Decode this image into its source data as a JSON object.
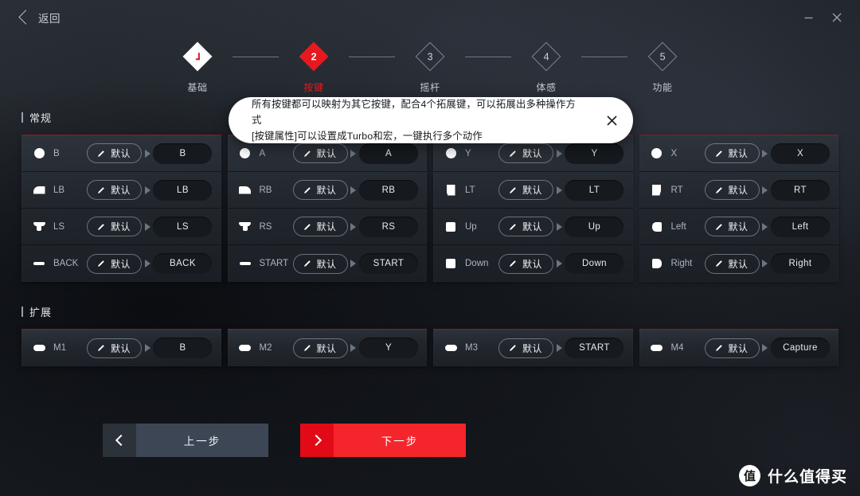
{
  "titlebar": {
    "back_label": "返回",
    "minimize_icon": "minimize-icon",
    "close_icon": "close-icon"
  },
  "stepper": {
    "steps": [
      {
        "num": "",
        "label": "基础",
        "state": "done"
      },
      {
        "num": "2",
        "label": "按键",
        "state": "active"
      },
      {
        "num": "3",
        "label": "摇杆",
        "state": "todo"
      },
      {
        "num": "4",
        "label": "体感",
        "state": "todo"
      },
      {
        "num": "5",
        "label": "功能",
        "state": "todo"
      }
    ],
    "active_color": "#e8191e"
  },
  "tooltip": {
    "line1": "所有按键都可以映射为其它按键，配合4个拓展键，可以拓展出多种操作方式",
    "line2": "[按键属性]可以设置成Turbo和宏，一键执行多个动作",
    "close_icon": "close-icon"
  },
  "sections": [
    {
      "title": "常规",
      "columns": [
        {
          "rows": [
            {
              "icon": "face-button-icon",
              "icon_shape": "face",
              "name": "B",
              "mode": "默认",
              "target": "B"
            },
            {
              "icon": "left-bumper-icon",
              "icon_shape": "bumperL",
              "name": "LB",
              "mode": "默认",
              "target": "LB"
            },
            {
              "icon": "left-stick-icon",
              "icon_shape": "stick",
              "name": "LS",
              "mode": "默认",
              "target": "LS"
            },
            {
              "icon": "back-button-icon",
              "icon_shape": "dash",
              "name": "BACK",
              "mode": "默认",
              "target": "BACK"
            }
          ]
        },
        {
          "rows": [
            {
              "icon": "face-button-icon",
              "icon_shape": "face",
              "name": "A",
              "mode": "默认",
              "target": "A"
            },
            {
              "icon": "right-bumper-icon",
              "icon_shape": "bumperR",
              "name": "RB",
              "mode": "默认",
              "target": "RB"
            },
            {
              "icon": "right-stick-icon",
              "icon_shape": "stick",
              "name": "RS",
              "mode": "默认",
              "target": "RS"
            },
            {
              "icon": "start-button-icon",
              "icon_shape": "dash",
              "name": "START",
              "mode": "默认",
              "target": "START"
            }
          ]
        },
        {
          "rows": [
            {
              "icon": "face-button-icon",
              "icon_shape": "face",
              "name": "Y",
              "mode": "默认",
              "target": "Y"
            },
            {
              "icon": "left-trigger-icon",
              "icon_shape": "trigL",
              "name": "LT",
              "mode": "默认",
              "target": "LT"
            },
            {
              "icon": "dpad-up-icon",
              "icon_shape": "dpad",
              "name": "Up",
              "mode": "默认",
              "target": "Up"
            },
            {
              "icon": "dpad-down-icon",
              "icon_shape": "dpad",
              "name": "Down",
              "mode": "默认",
              "target": "Down"
            }
          ]
        },
        {
          "rows": [
            {
              "icon": "face-button-icon",
              "icon_shape": "face",
              "name": "X",
              "mode": "默认",
              "target": "X"
            },
            {
              "icon": "right-trigger-icon",
              "icon_shape": "trigR",
              "name": "RT",
              "mode": "默认",
              "target": "RT"
            },
            {
              "icon": "dpad-left-icon",
              "icon_shape": "dpadL",
              "name": "Left",
              "mode": "默认",
              "target": "Left"
            },
            {
              "icon": "dpad-right-icon",
              "icon_shape": "dpadR",
              "name": "Right",
              "mode": "默认",
              "target": "Right"
            }
          ]
        }
      ]
    },
    {
      "title": "扩展",
      "columns": [
        {
          "rows": [
            {
              "icon": "macro-button-icon",
              "icon_shape": "mbtn",
              "name": "M1",
              "mode": "默认",
              "target": "B"
            }
          ]
        },
        {
          "rows": [
            {
              "icon": "macro-button-icon",
              "icon_shape": "mbtn",
              "name": "M2",
              "mode": "默认",
              "target": "Y"
            }
          ]
        },
        {
          "rows": [
            {
              "icon": "macro-button-icon",
              "icon_shape": "mbtn",
              "name": "M3",
              "mode": "默认",
              "target": "START"
            }
          ]
        },
        {
          "rows": [
            {
              "icon": "macro-button-icon",
              "icon_shape": "mbtn",
              "name": "M4",
              "mode": "默认",
              "target": "Capture"
            }
          ]
        }
      ]
    }
  ],
  "nav": {
    "prev_label": "上一步",
    "next_label": "下一步",
    "prev_icon": "chevron-left-icon",
    "next_icon": "chevron-right-icon"
  },
  "watermark": {
    "logo_char": "值",
    "text": "什么值得买"
  }
}
